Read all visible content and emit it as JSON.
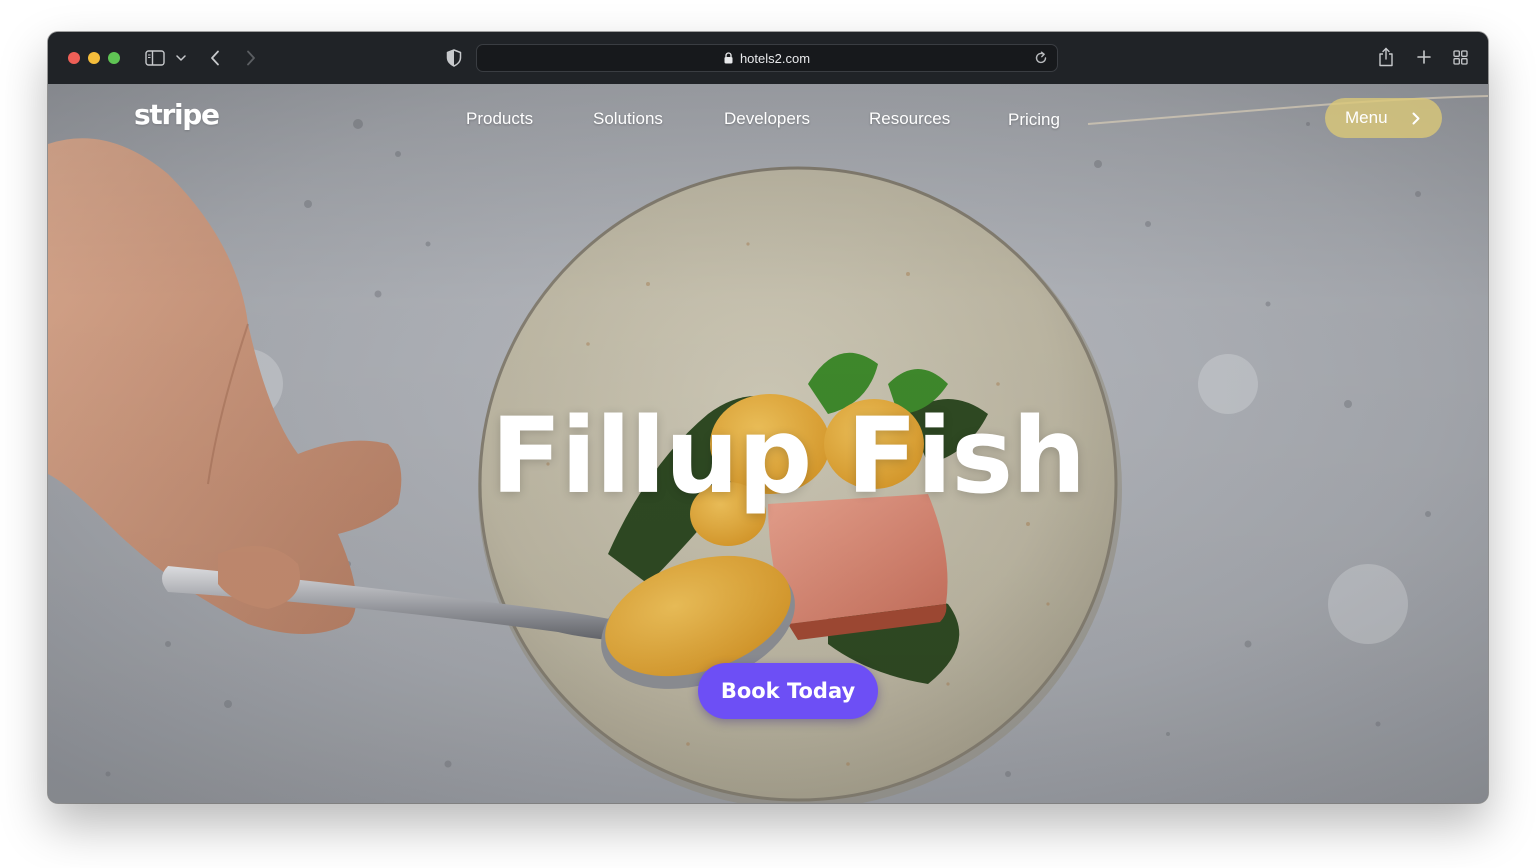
{
  "browser": {
    "url": "hotels2.com",
    "icons": {
      "sidebar": "sidebar-icon",
      "sidebar_menu": "chevron-down-icon",
      "back": "chevron-left-icon",
      "forward": "chevron-right-icon",
      "privacy": "shield-icon",
      "lock": "lock-icon",
      "reload": "reload-icon",
      "share": "share-icon",
      "new_tab": "plus-icon",
      "tab_overview": "grid-icon"
    }
  },
  "site": {
    "logo": "stripe",
    "nav": {
      "items": [
        {
          "label": "Products"
        },
        {
          "label": "Solutions"
        },
        {
          "label": "Developers"
        },
        {
          "label": "Resources"
        },
        {
          "label": "Pricing"
        }
      ],
      "menu_label": "Menu"
    },
    "hero": {
      "title": "Fillup Fish",
      "cta_label": "Book Today"
    }
  },
  "colors": {
    "accent": "#6d4ff5",
    "menu_pill": "#dbc878",
    "traffic_close": "#ee5f57",
    "traffic_minimize": "#f5bd3b",
    "traffic_zoom": "#5fc454"
  }
}
